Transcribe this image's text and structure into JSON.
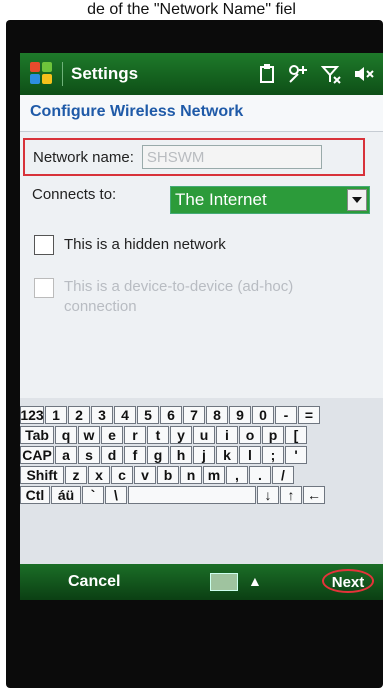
{
  "caption": "de of the \"Network Name\" fiel",
  "titlebar": {
    "app_title": "Settings"
  },
  "page": {
    "header": "Configure Wireless Network"
  },
  "form": {
    "network_name_label": "Network name:",
    "network_name_value": "SHSWM",
    "connects_to_label": "Connects to:",
    "connects_to_value": "The Internet",
    "hidden_network_label": "This is a hidden network",
    "adhoc_label_line1": "This is a device-to-device (ad-hoc)",
    "adhoc_label_line2": "connection"
  },
  "keyboard": {
    "row1": [
      "123",
      "1",
      "2",
      "3",
      "4",
      "5",
      "6",
      "7",
      "8",
      "9",
      "0",
      "-",
      "="
    ],
    "row2": [
      "Tab",
      "q",
      "w",
      "e",
      "r",
      "t",
      "y",
      "u",
      "i",
      "o",
      "p",
      "["
    ],
    "row3": [
      "CAP",
      "a",
      "s",
      "d",
      "f",
      "g",
      "h",
      "j",
      "k",
      "l",
      ";",
      "'"
    ],
    "row4": [
      "Shift",
      "z",
      "x",
      "c",
      "v",
      "b",
      "n",
      "m",
      ",",
      ".",
      "/"
    ],
    "row5": [
      "Ctl",
      "áü",
      "`",
      "\\",
      "",
      "↓",
      "↑",
      "←"
    ]
  },
  "softkeys": {
    "left": "Cancel",
    "right": "Next"
  }
}
